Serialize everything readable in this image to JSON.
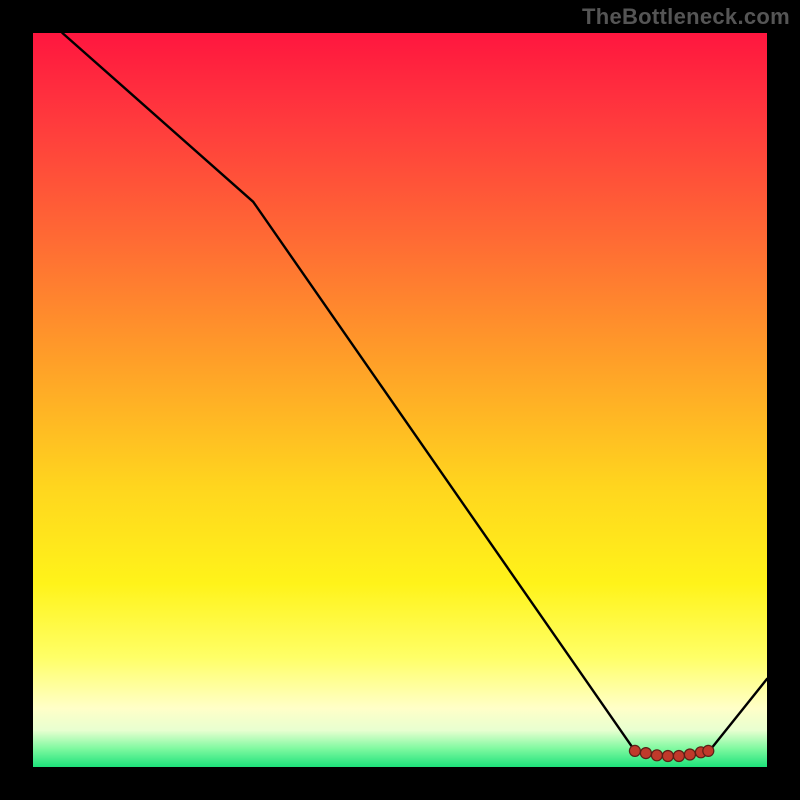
{
  "watermark": "TheBottleneck.com",
  "chart_data": {
    "type": "line",
    "title": "",
    "xlabel": "",
    "ylabel": "",
    "xlim": [
      0,
      100
    ],
    "ylim": [
      0,
      100
    ],
    "grid": false,
    "legend": false,
    "background": "heat-gradient-vertical",
    "series": [
      {
        "name": "curve",
        "x": [
          4,
          30,
          82,
          84,
          86,
          88,
          90,
          92,
          100
        ],
        "values": [
          100,
          77,
          2.2,
          1.6,
          1.4,
          1.4,
          1.6,
          2.0,
          12
        ]
      }
    ],
    "markers": {
      "name": "bottom-cluster",
      "x": [
        82,
        83.5,
        85,
        86.5,
        88,
        89.5,
        91,
        92
      ],
      "values": [
        2.2,
        1.9,
        1.6,
        1.5,
        1.5,
        1.7,
        2.0,
        2.2
      ]
    }
  }
}
